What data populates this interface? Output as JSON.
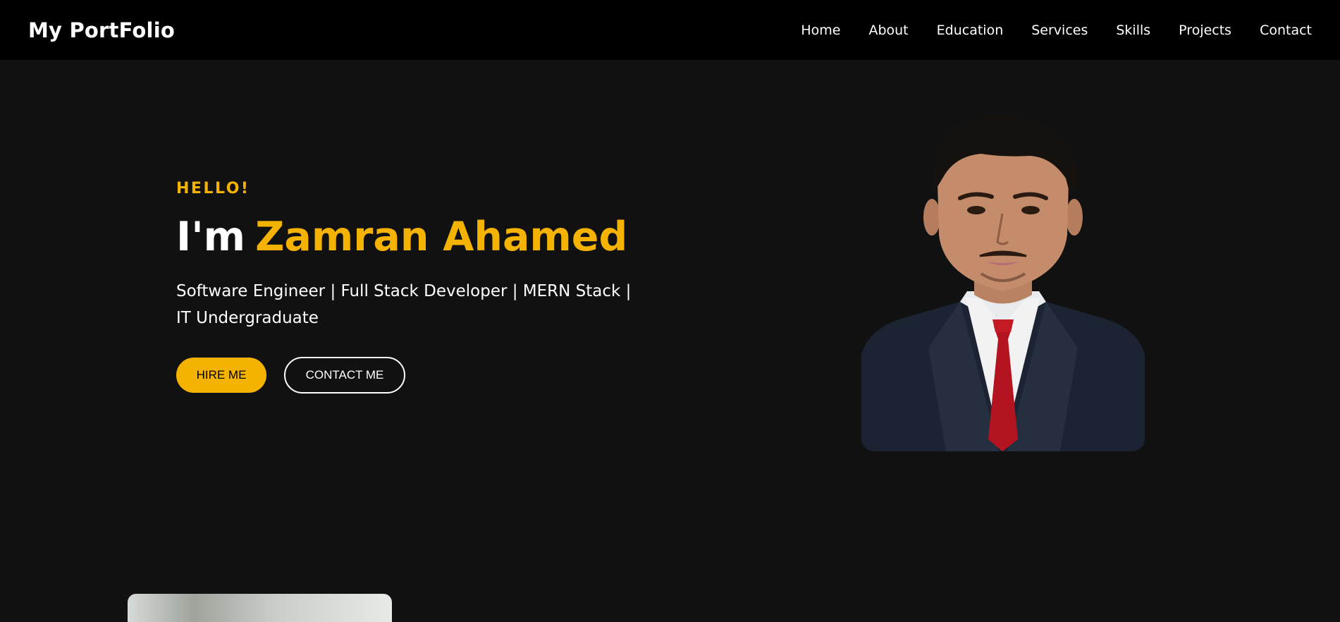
{
  "navbar": {
    "brand": "My PortFolio",
    "links": [
      "Home",
      "About",
      "Education",
      "Services",
      "Skills",
      "Projects",
      "Contact"
    ]
  },
  "hero": {
    "greeting": "HELLO!",
    "headline_prefix": "I'm",
    "name": "Zamran Ahamed",
    "tagline": "Software Engineer | Full Stack Developer | MERN Stack | IT Undergraduate",
    "hire_button": "HIRE ME",
    "contact_button": "CONTACT ME",
    "portrait_icon": "profile-photo"
  },
  "colors": {
    "accent": "#f5b301",
    "background": "#111111",
    "navbar": "#000000"
  }
}
